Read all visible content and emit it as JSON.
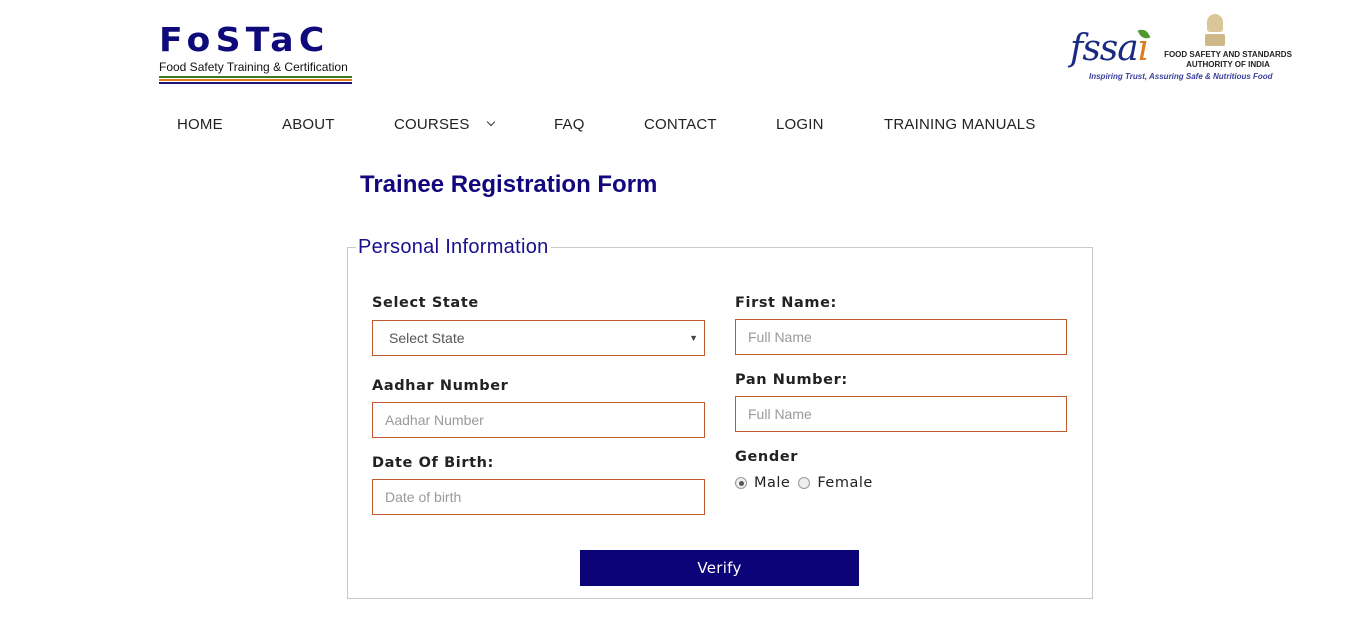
{
  "header": {
    "logo": {
      "wordmark": "FoSTaC",
      "tagline": "Food Safety Training & Certification",
      "stripe_colors": [
        "#3d7a1e",
        "#e07a1f",
        "#1a1577"
      ]
    },
    "partner_logo": {
      "mark": "fssa",
      "mark_accent": "i",
      "name_line1": "FOOD SAFETY AND STANDARDS",
      "name_line2": "AUTHORITY OF INDIA",
      "slogan": "Inspiring Trust, Assuring Safe & Nutritious Food"
    }
  },
  "nav": {
    "items": [
      {
        "label": "HOME"
      },
      {
        "label": "ABOUT"
      },
      {
        "label": "COURSES",
        "icon": "chevron-down-icon"
      },
      {
        "label": "FAQ"
      },
      {
        "label": "CONTACT"
      },
      {
        "label": "LOGIN"
      },
      {
        "label": "TRAINING MANUALS"
      }
    ]
  },
  "page": {
    "title": "Trainee Registration Form"
  },
  "form": {
    "section_title": "Personal Information",
    "state": {
      "label": "Select State",
      "selected": "Select State",
      "icon": "dropdown-arrow-icon"
    },
    "first_name": {
      "label": "First Name:",
      "placeholder": "Full Name",
      "value": ""
    },
    "aadhar": {
      "label": "Aadhar Number",
      "placeholder": "Aadhar Number",
      "value": ""
    },
    "pan": {
      "label": "Pan Number:",
      "placeholder": "Full Name",
      "value": ""
    },
    "dob": {
      "label": "Date Of Birth:",
      "placeholder": "Date of birth",
      "value": ""
    },
    "gender": {
      "label": "Gender",
      "options": [
        {
          "label": "Male",
          "checked": true
        },
        {
          "label": "Female",
          "checked": false
        }
      ]
    },
    "submit_label": "Verify"
  },
  "colors": {
    "brand_navy": "#0c0378",
    "title_blue": "#14067c",
    "input_border": "#c05a2e"
  }
}
